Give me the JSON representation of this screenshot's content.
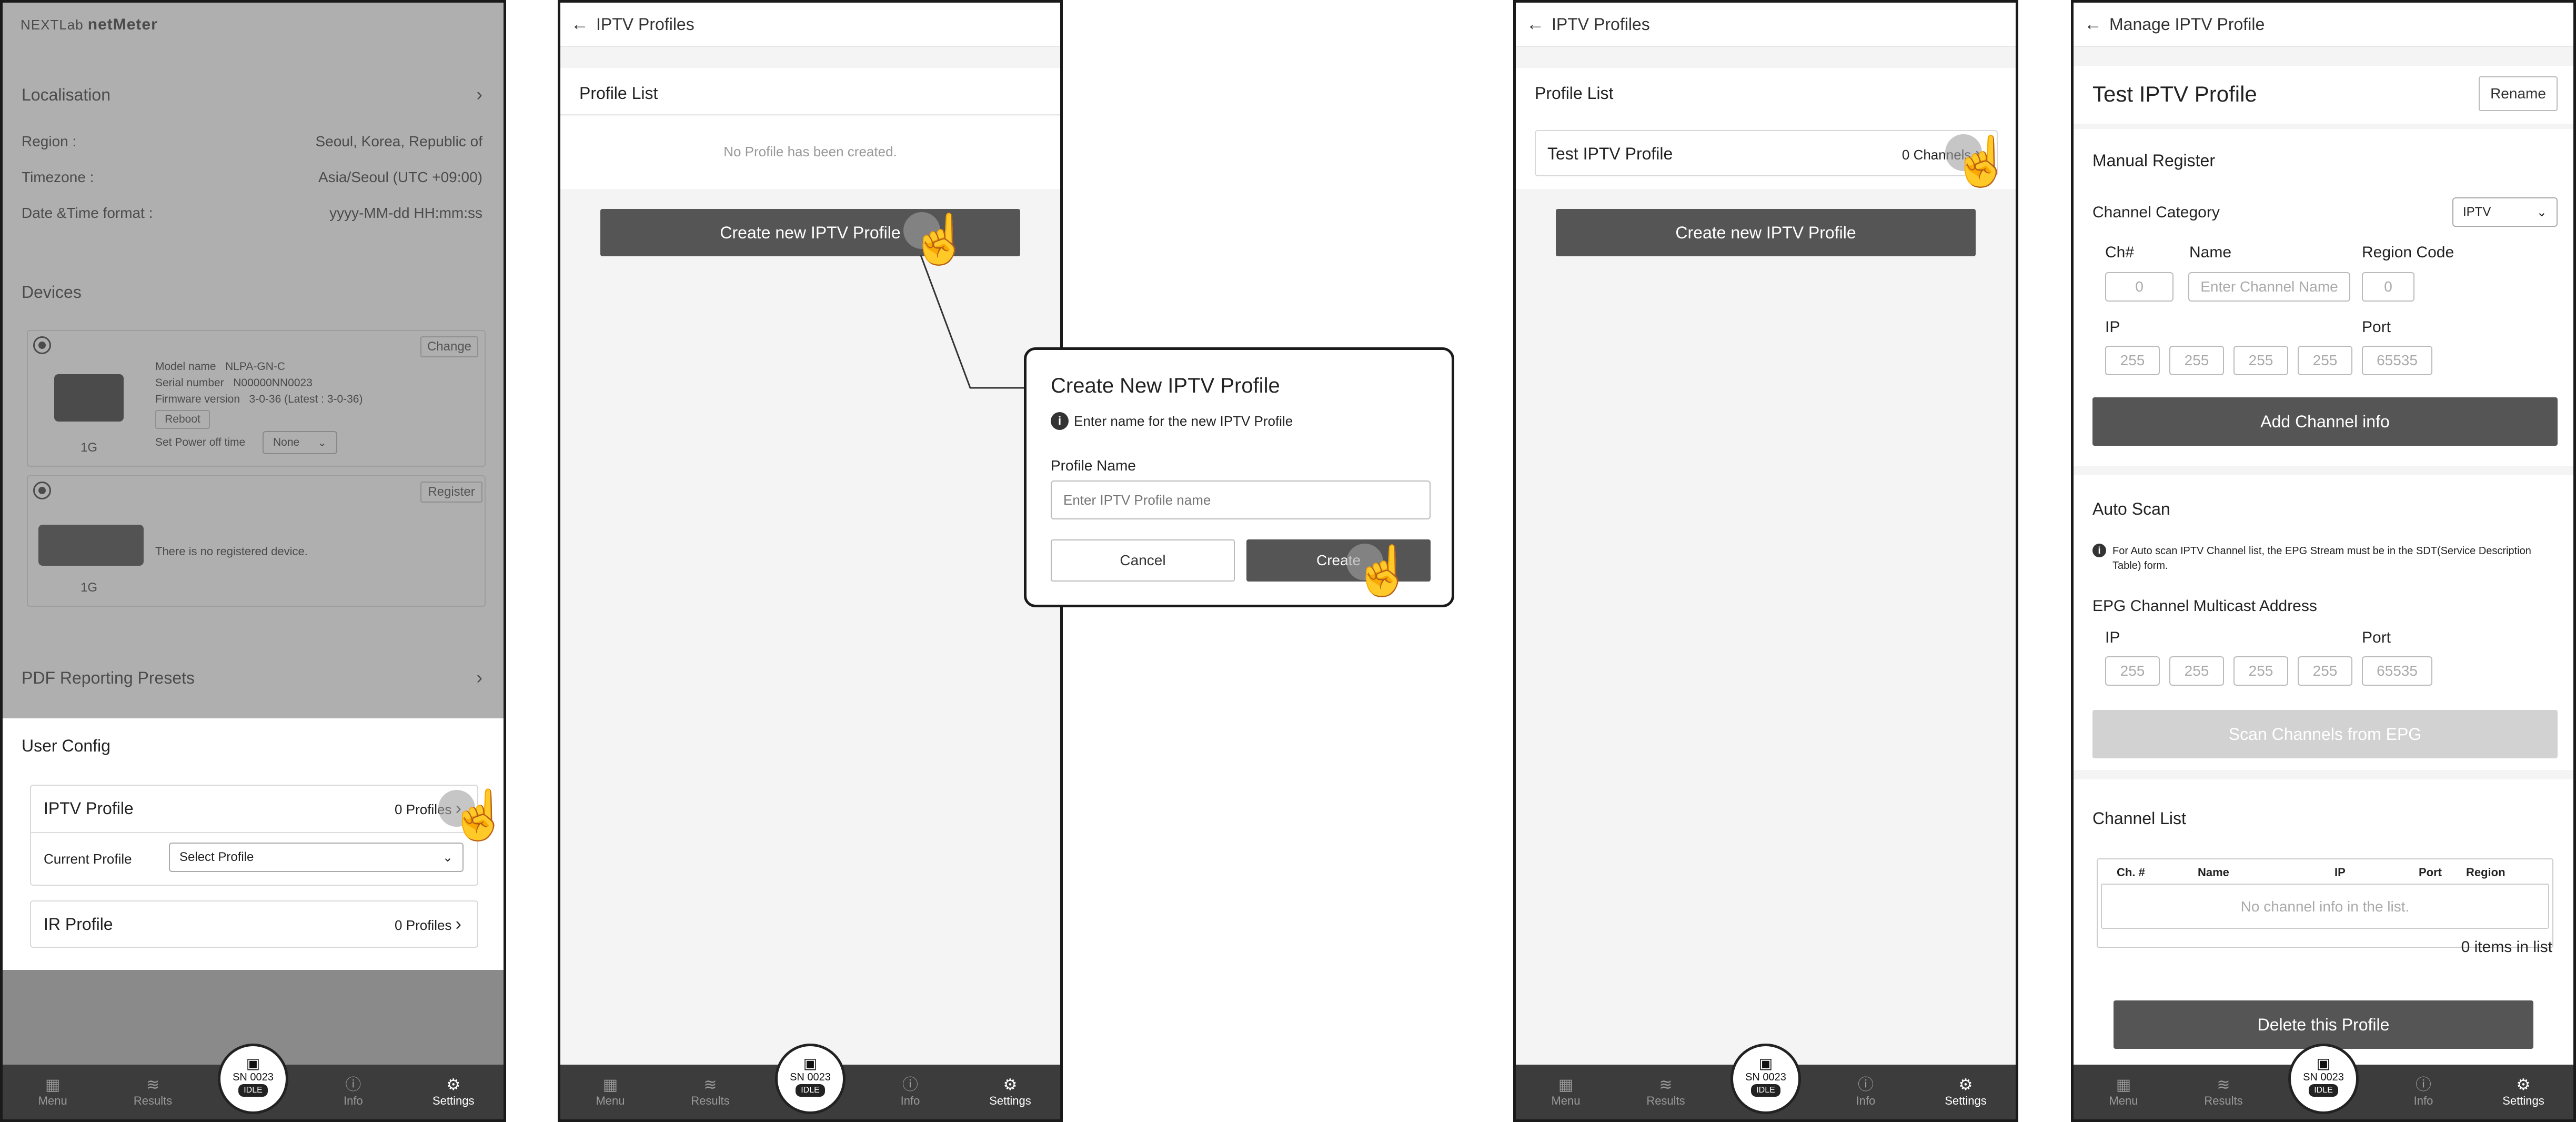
{
  "p1": {
    "brand_small": "NEXTLab",
    "brand": "netMeter",
    "localisation": {
      "title": "Localisation",
      "region_label": "Region :",
      "region_value": "Seoul, Korea, Republic of",
      "tz_label": "Timezone :",
      "tz_value": "Asia/Seoul (UTC +09:00)",
      "dt_label": "Date &Time format :",
      "dt_value": "yyyy-MM-dd HH:mm:ss"
    },
    "devices": {
      "title": "Devices",
      "d1": {
        "change": "Change",
        "model_label": "Model name",
        "model": "NLPA-GN-C",
        "serial_label": "Serial number",
        "serial": "N00000NN0023",
        "fw_label": "Firmware version",
        "fw": "3-0-36 (Latest : 3-0-36)",
        "reboot": "Reboot",
        "power_label": "Set Power off time",
        "power_value": "None",
        "tag": "1G"
      },
      "d2": {
        "register": "Register",
        "msg": "There is no registered device.",
        "tag": "1G"
      }
    },
    "pdf": "PDF Reporting Presets",
    "user_config": "User Config",
    "iptv_profile": "IPTV Profile",
    "iptv_count": "0 Profiles",
    "current_profile": "Current Profile",
    "select_profile": "Select Profile",
    "ir_profile": "IR Profile",
    "ir_count": "0 Profiles"
  },
  "nav": {
    "menu": "Menu",
    "results": "Results",
    "info": "Info",
    "settings": "Settings",
    "sn": "SN 0023",
    "idle": "IDLE"
  },
  "p2": {
    "title": "IPTV Profiles",
    "list_title": "Profile List",
    "empty": "No Profile has been created.",
    "create_btn": "Create new IPTV Profile"
  },
  "dialog": {
    "title": "Create New IPTV Profile",
    "hint": "Enter name for the new IPTV Profile",
    "field_label": "Profile Name",
    "placeholder": "Enter IPTV Profile name",
    "cancel": "Cancel",
    "create": "Create"
  },
  "p3": {
    "title": "IPTV Profiles",
    "list_title": "Profile List",
    "item_name": "Test IPTV Profile",
    "item_count": "0 Channels",
    "create_btn": "Create new IPTV Profile"
  },
  "p4": {
    "title": "Manage IPTV Profile",
    "profile_name": "Test IPTV Profile",
    "rename": "Rename",
    "manual": "Manual Register",
    "category_label": "Channel Category",
    "category_value": "IPTV",
    "ch_label": "Ch#",
    "name_label": "Name",
    "region_label": "Region Code",
    "ch_ph": "0",
    "name_ph": "Enter Channel Name",
    "region_ph": "0",
    "ip_label": "IP",
    "port_label": "Port",
    "ip_ph": "255",
    "port_ph": "65535",
    "add_btn": "Add Channel info",
    "auto_scan": "Auto Scan",
    "auto_note": "For Auto scan IPTV Channel list, the EPG Stream must be in the SDT(Service Description Table) form.",
    "epg_title": "EPG Channel Multicast Address",
    "scan_btn": "Scan Channels from EPG",
    "channel_list": "Channel List",
    "cols": [
      "Ch. #",
      "Name",
      "IP",
      "Port",
      "Region"
    ],
    "empty": "No channel info in the list.",
    "items": "0 items in list",
    "delete_btn": "Delete this Profile"
  }
}
